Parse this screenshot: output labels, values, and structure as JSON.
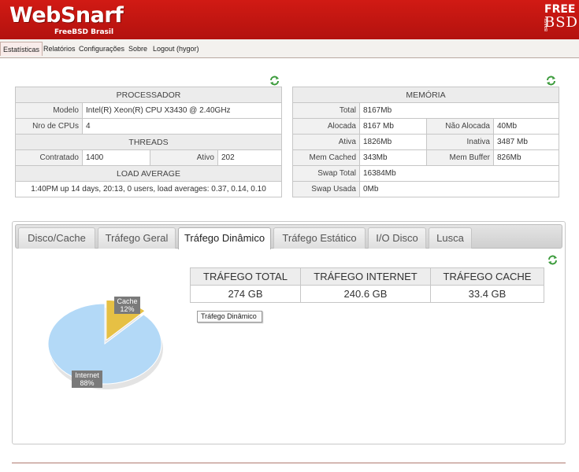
{
  "header": {
    "brand": "WebSnarf",
    "subtitle": "FreeBSD Brasil",
    "logo_top": "FREE",
    "logo_bottom": "BSD",
    "logo_side": "BRASIL"
  },
  "menu": {
    "items": [
      "Estatísticas",
      "Relatórios",
      "Configurações",
      "Sobre",
      "Logout (hygor)"
    ],
    "active": "Estatísticas"
  },
  "processador": {
    "title": "PROCESSADOR",
    "modelo_label": "Modelo",
    "modelo_value": "Intel(R) Xeon(R) CPU X3430 @ 2.40GHz",
    "cpus_label": "Nro de CPUs",
    "cpus_value": "4",
    "threads_title": "THREADS",
    "contratado_label": "Contratado",
    "contratado_value": "1400",
    "ativo_label": "Ativo",
    "ativo_value": "202",
    "load_title": "LOAD AVERAGE",
    "load_value": "1:40PM up 14 days, 20:13, 0 users, load averages: 0.37, 0.14, 0.10"
  },
  "memoria": {
    "title": "MEMÓRIA",
    "total_label": "Total",
    "total_value": "8167Mb",
    "alocada_label": "Alocada",
    "alocada_value": "8167 Mb",
    "nao_alocada_label": "Não Alocada",
    "nao_alocada_value": "40Mb",
    "ativa_label": "Ativa",
    "ativa_value": "1826Mb",
    "inativa_label": "Inativa",
    "inativa_value": "3487 Mb",
    "mem_cached_label": "Mem Cached",
    "mem_cached_value": "343Mb",
    "mem_buffer_label": "Mem Buffer",
    "mem_buffer_value": "826Mb",
    "swap_total_label": "Swap Total",
    "swap_total_value": "16384Mb",
    "swap_usada_label": "Swap Usada",
    "swap_usada_value": "0Mb"
  },
  "tabs": [
    {
      "label": "Disco/Cache"
    },
    {
      "label": "Tráfego Geral"
    },
    {
      "label": "Tráfego Dinâmico"
    },
    {
      "label": "Tráfego Estático"
    },
    {
      "label": "I/O Disco"
    },
    {
      "label": "Lusca"
    }
  ],
  "active_tab": "Tráfego Dinâmico",
  "traffic": {
    "headers": [
      "TRÁFEGO TOTAL",
      "TRÁFEGO INTERNET",
      "TRÁFEGO CACHE"
    ],
    "values": [
      "274 GB",
      "240.6 GB",
      "33.4 GB"
    ]
  },
  "chart_data": {
    "type": "pie",
    "title": "Tráfego Dinâmico",
    "slices": [
      {
        "label": "Internet",
        "value": 88,
        "display": "88%",
        "color": "#b3d9f7"
      },
      {
        "label": "Cache",
        "value": 12,
        "display": "12%",
        "color": "#e6c044"
      }
    ]
  },
  "colors": {
    "header_red": "#c4160f",
    "refresh_green": "#3a9a3a"
  },
  "icons": {
    "refresh": "refresh-icon"
  }
}
